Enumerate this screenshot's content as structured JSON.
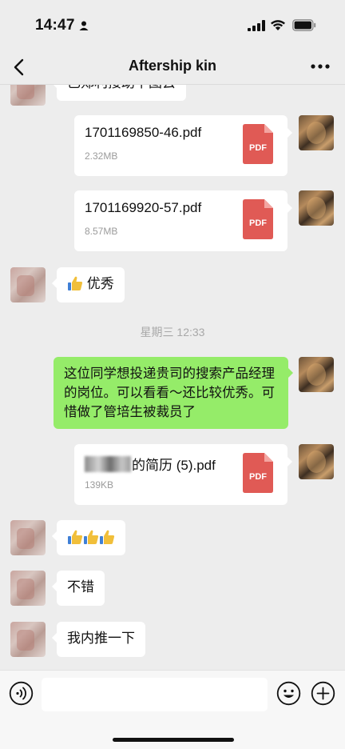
{
  "status_bar": {
    "time": "14:47"
  },
  "nav": {
    "title": "Aftership kin"
  },
  "messages": {
    "cropped_text": "已郑利接助下图去",
    "file1": {
      "name": "1701169850-46.pdf",
      "size": "2.32MB",
      "icon": "PDF"
    },
    "file2": {
      "name": "1701169920-57.pdf",
      "size": "8.57MB",
      "icon": "PDF"
    },
    "excellent": "优秀",
    "timestamp": "星期三 12:33",
    "referral": "这位同学想投递贵司的搜索产品经理的岗位。可以看看～还比较优秀。可惜做了管培生被裁员了",
    "file3": {
      "name_suffix": "的简历 (5).pdf",
      "size": "139KB",
      "icon": "PDF"
    },
    "not_bad": "不错",
    "push": "我内推一下"
  },
  "input": {
    "placeholder": ""
  },
  "colors": {
    "background": "#ededed",
    "sent_bubble": "#95ec69",
    "pdf_red": "#e05a55"
  },
  "icons": [
    "back-icon",
    "more-icon",
    "voice-icon",
    "emoji-icon",
    "plus-icon",
    "pdf-icon",
    "thumbs-up-icon"
  ]
}
